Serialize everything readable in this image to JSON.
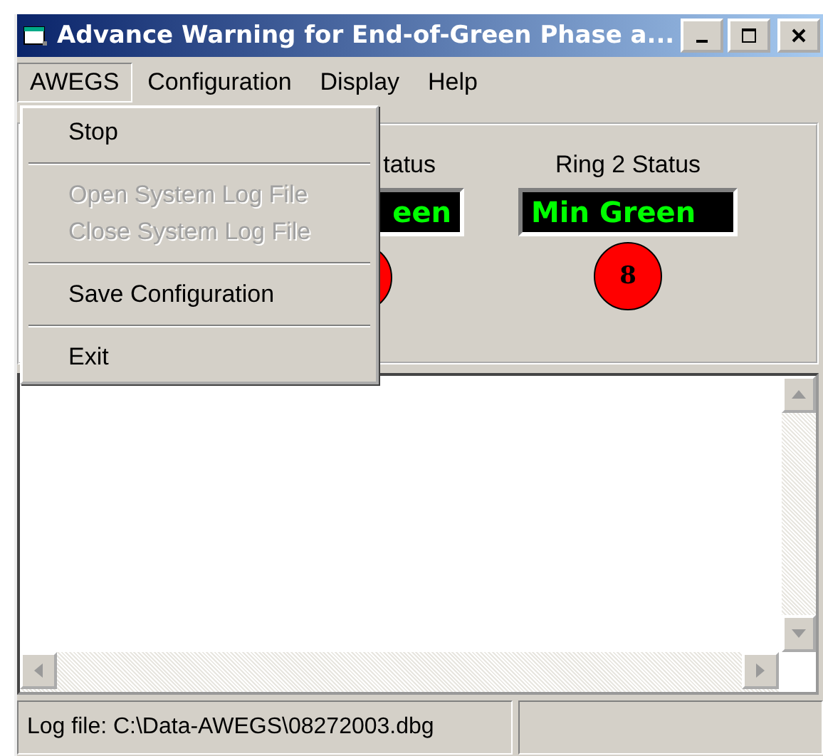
{
  "window": {
    "title": "Advance Warning for End-of-Green Phase a..."
  },
  "menu_bar": [
    {
      "label": "AWEGS",
      "selected": true
    },
    {
      "label": "Configuration",
      "selected": false
    },
    {
      "label": "Display",
      "selected": false
    },
    {
      "label": "Help",
      "selected": false
    }
  ],
  "dropdown": [
    {
      "kind": "item",
      "label": "Stop",
      "disabled": false
    },
    {
      "kind": "separator"
    },
    {
      "kind": "item",
      "label": "Open System Log File",
      "disabled": true
    },
    {
      "kind": "item",
      "label": "Close System Log File",
      "disabled": true
    },
    {
      "kind": "separator"
    },
    {
      "kind": "item",
      "label": "Save Configuration",
      "disabled": false
    },
    {
      "kind": "separator"
    },
    {
      "kind": "item",
      "label": "Exit",
      "disabled": false
    }
  ],
  "rings": [
    {
      "label": "tatus",
      "display": "een"
    },
    {
      "label": "Ring 2 Status",
      "display": "Min Green",
      "number": "8"
    }
  ],
  "status_bar": {
    "log_file": "Log file: C:\\Data-AWEGS\\08272003.dbg"
  }
}
